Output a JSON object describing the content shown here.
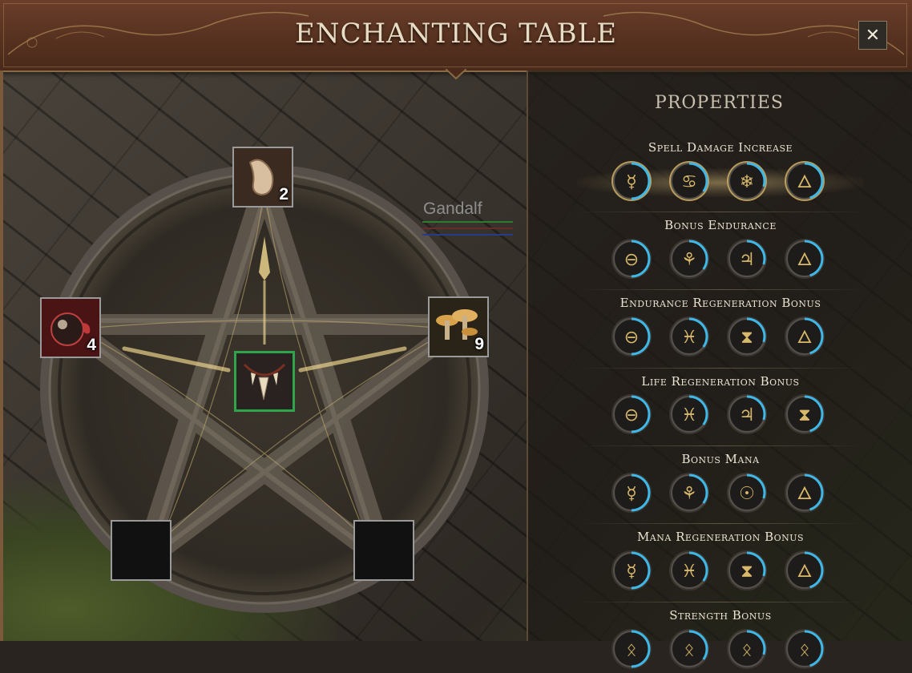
{
  "header": {
    "title": "ENCHANTING TABLE",
    "close_label": "✕"
  },
  "table": {
    "slots": [
      {
        "id": "top",
        "item_icon": "bone-icon",
        "count": "2"
      },
      {
        "id": "left",
        "item_icon": "eye-orb-icon",
        "count": "4"
      },
      {
        "id": "right",
        "item_icon": "mushrooms-icon",
        "count": "9"
      },
      {
        "id": "center",
        "item_icon": "fang-necklace-icon",
        "count": ""
      },
      {
        "id": "bottom-left",
        "item_icon": "",
        "count": ""
      },
      {
        "id": "bottom-right",
        "item_icon": "",
        "count": ""
      }
    ]
  },
  "world": {
    "character_name": "Gandalf",
    "bar_colors": [
      "#2f7a2f",
      "#6a2a2a",
      "#2a3a8a"
    ]
  },
  "properties": {
    "heading": "PROPERTIES",
    "items": [
      {
        "name": "Spell Damage Increase",
        "runes": [
          "mercury-icon",
          "cancer-icon",
          "snowflake-icon",
          "flame-icon"
        ],
        "active": true
      },
      {
        "name": "Bonus Endurance",
        "runes": [
          "theta-icon",
          "leaf-icon",
          "jupiter-icon",
          "flame-icon"
        ],
        "active": false
      },
      {
        "name": "Endurance Regeneration Bonus",
        "runes": [
          "theta-icon",
          "pisces-icon",
          "hourglass-icon",
          "flame-icon"
        ],
        "active": false
      },
      {
        "name": "Life Regeneration Bonus",
        "runes": [
          "theta-icon",
          "pisces-icon",
          "jupiter-icon",
          "hourglass-icon"
        ],
        "active": false
      },
      {
        "name": "Bonus Mana",
        "runes": [
          "mercury-icon",
          "leaf-icon",
          "sun-icon",
          "flame-icon"
        ],
        "active": false
      },
      {
        "name": "Mana Regeneration Bonus",
        "runes": [
          "mercury-icon",
          "pisces-icon",
          "hourglass-icon",
          "flame-icon"
        ],
        "active": false
      },
      {
        "name": "Strength Bonus",
        "runes": [
          "rune-icon",
          "rune-icon",
          "rune-icon",
          "rune-icon"
        ],
        "active": false
      }
    ]
  },
  "colors": {
    "accent_gold": "#d8b86a",
    "rune_ring": "#3fb8e8",
    "selected_slot": "#2fa44a"
  }
}
